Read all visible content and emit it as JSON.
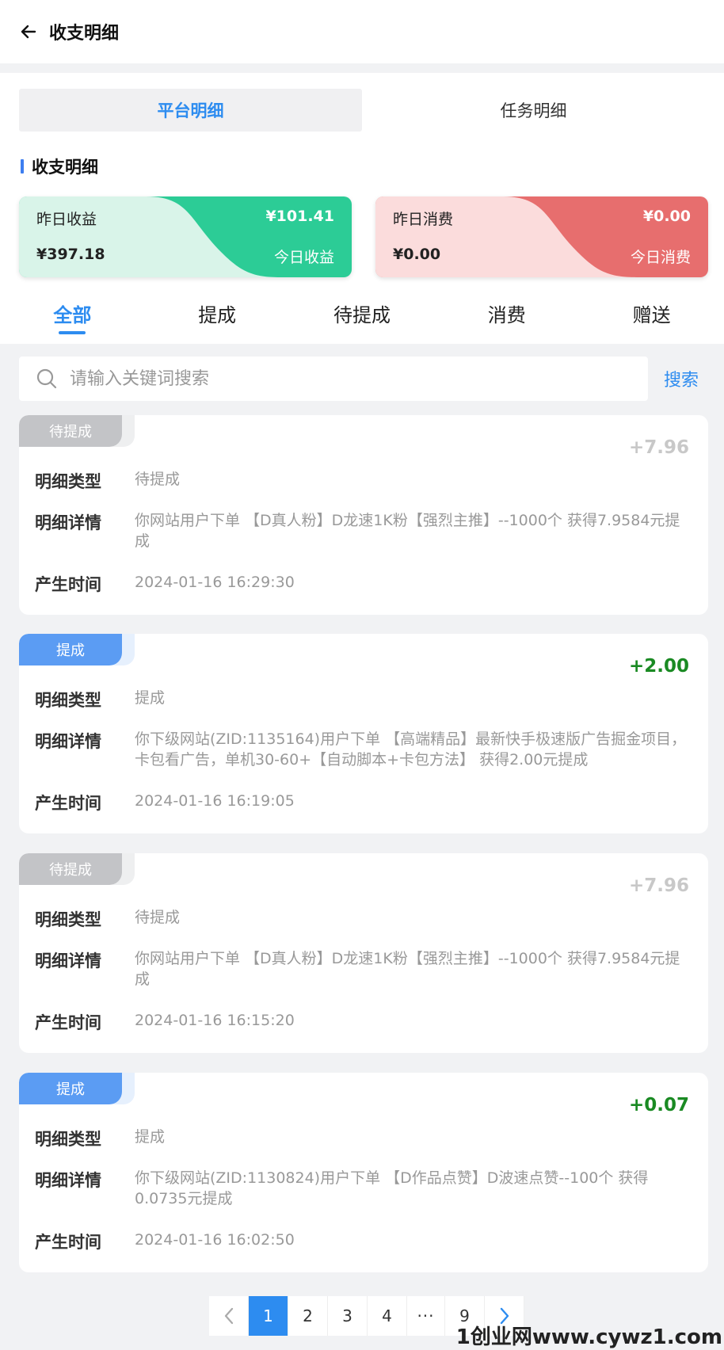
{
  "header": {
    "title": "收支明细"
  },
  "segments": {
    "items": [
      "平台明细",
      "任务明细"
    ]
  },
  "section": {
    "title": "收支明细"
  },
  "income_card": {
    "label_left_top": "昨日收益",
    "value_left_bottom": "¥397.18",
    "value_right_top": "¥101.41",
    "label_right_bottom": "今日收益",
    "color_start": "#e0f5ec",
    "color_end": "#2dcc96"
  },
  "expense_card": {
    "label_left_top": "昨日消费",
    "value_left_bottom": "¥0.00",
    "value_right_top": "¥0.00",
    "label_right_bottom": "今日消费",
    "color_start": "#fde6e6",
    "color_end": "#e86f6f"
  },
  "tabs": [
    "全部",
    "提成",
    "待提成",
    "消费",
    "赠送"
  ],
  "search": {
    "placeholder": "请输入关键词搜索",
    "button": "搜索"
  },
  "field_labels": {
    "type": "明细类型",
    "detail": "明细详情",
    "time": "产生时间"
  },
  "records": [
    {
      "badge": "待提成",
      "amount": "+7.96",
      "type": "待提成",
      "detail": "你网站用户下单 【D真人粉】D龙速1K粉【强烈主推】--1000个 获得7.9584元提成",
      "time": "2024-01-16 16:29:30"
    },
    {
      "badge": "提成",
      "amount": "+2.00",
      "type": "提成",
      "detail": "你下级网站(ZID:1135164)用户下单 【高端精品】最新快手极速版广告掘金项目，卡包看广告，单机30-60+【自动脚本+卡包方法】 获得2.00元提成",
      "time": "2024-01-16 16:19:05"
    },
    {
      "badge": "待提成",
      "amount": "+7.96",
      "type": "待提成",
      "detail": "你网站用户下单 【D真人粉】D龙速1K粉【强烈主推】--1000个 获得7.9584元提成",
      "time": "2024-01-16 16:15:20"
    },
    {
      "badge": "提成",
      "amount": "+0.07",
      "type": "提成",
      "detail": "你下级网站(ZID:1130824)用户下单 【D作品点赞】D波速点赞--100个 获得0.0735元提成",
      "time": "2024-01-16 16:02:50"
    }
  ],
  "pager": {
    "pages": [
      "1",
      "2",
      "3",
      "4",
      "···",
      "9"
    ],
    "current": "1"
  },
  "watermark": "1创业网www.cywz1.com"
}
